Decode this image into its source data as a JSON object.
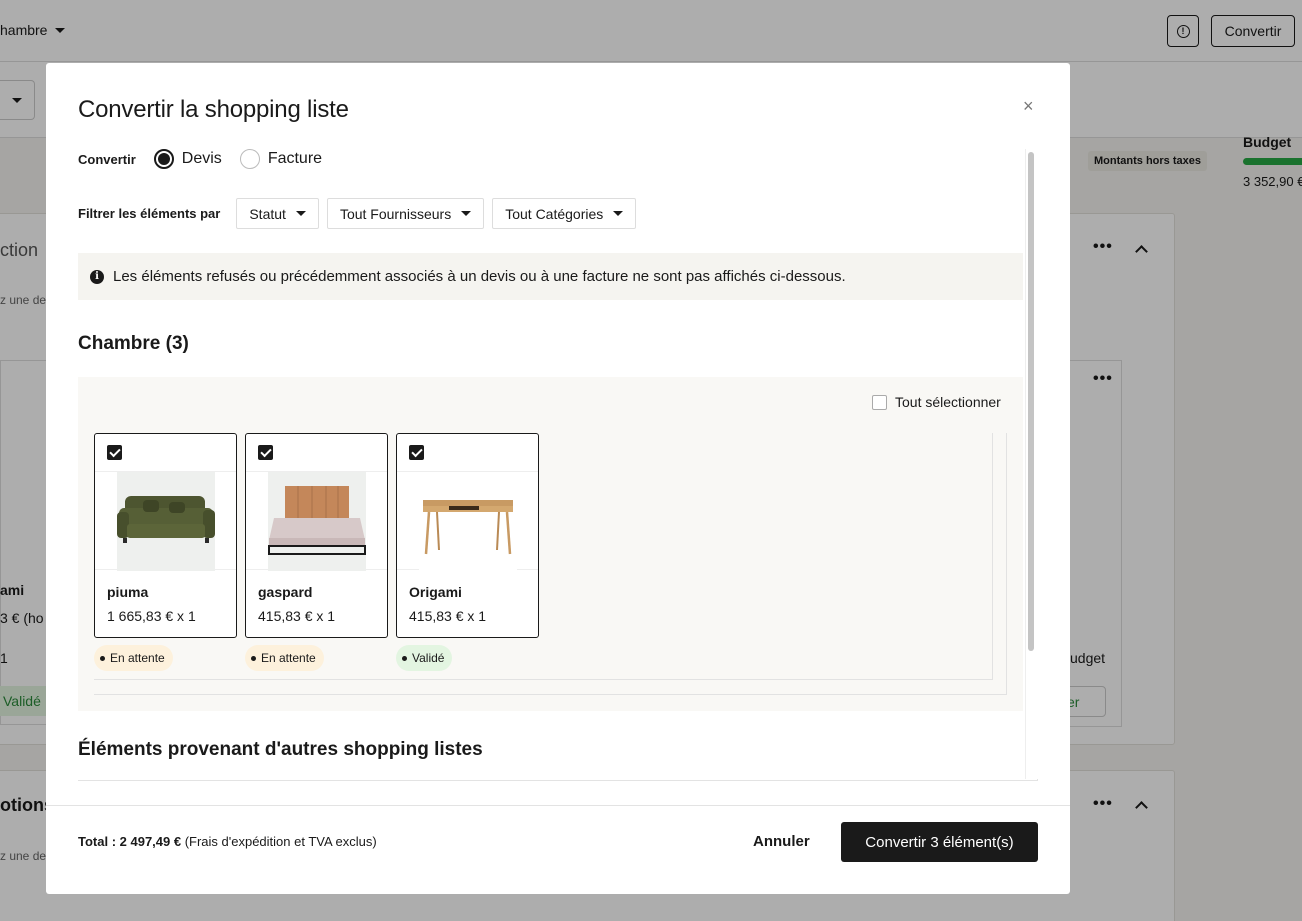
{
  "background": {
    "room_selector": "hambre",
    "convert_button": "Convertir",
    "ht_badge": "Montants hors taxes",
    "budget_label": "Budget",
    "budget_value": "3 352,90 €",
    "budget_fill_fraction": 1.0,
    "section1_title": "ction",
    "section1_sub": "z une de",
    "card_name": "ami",
    "card_price": "3 € (ho",
    "card_qty": "1",
    "card_status": "Validé",
    "right_budget_text": "udget",
    "right_btn_text": "er",
    "section2_title": "otions",
    "section2_sub": "z une de"
  },
  "modal": {
    "title": "Convertir la shopping liste",
    "close_glyph": "×",
    "convert_label": "Convertir",
    "radio_devis": "Devis",
    "radio_facture": "Facture",
    "selected_type": "Devis",
    "filter_label": "Filtrer les éléments par",
    "filters": [
      "Statut",
      "Tout Fournisseurs",
      "Tout Catégories"
    ],
    "notice": "Les éléments refusés ou précédemment associés à un devis ou à une facture ne sont pas affichés ci-dessous.",
    "section_title": "Chambre (3)",
    "select_all": "Tout sélectionner",
    "products": [
      {
        "name": "piuma",
        "price": "1 665,83 € x 1",
        "status": "En attente",
        "checked": true,
        "image": "sofa-image"
      },
      {
        "name": "gaspard",
        "price": "415,83 € x 1",
        "status": "En attente",
        "checked": true,
        "image": "bed-image"
      },
      {
        "name": "Origami",
        "price": "415,83 € x 1",
        "status": "Validé",
        "checked": true,
        "image": "desk-image"
      }
    ],
    "section2_title": "Éléments provenant d'autres shopping listes",
    "total_prefix": "Total : ",
    "total_amount": "2 497,49 €",
    "total_suffix": " (Frais d'expédition et TVA exclus)",
    "cancel": "Annuler",
    "primary": "Convertir 3 élément(s)"
  },
  "colors": {
    "accent": "#1a1a1a",
    "pending_bg": "#fdf1dc",
    "validated_bg": "#e3f5e1",
    "budget_green": "#27a844"
  }
}
